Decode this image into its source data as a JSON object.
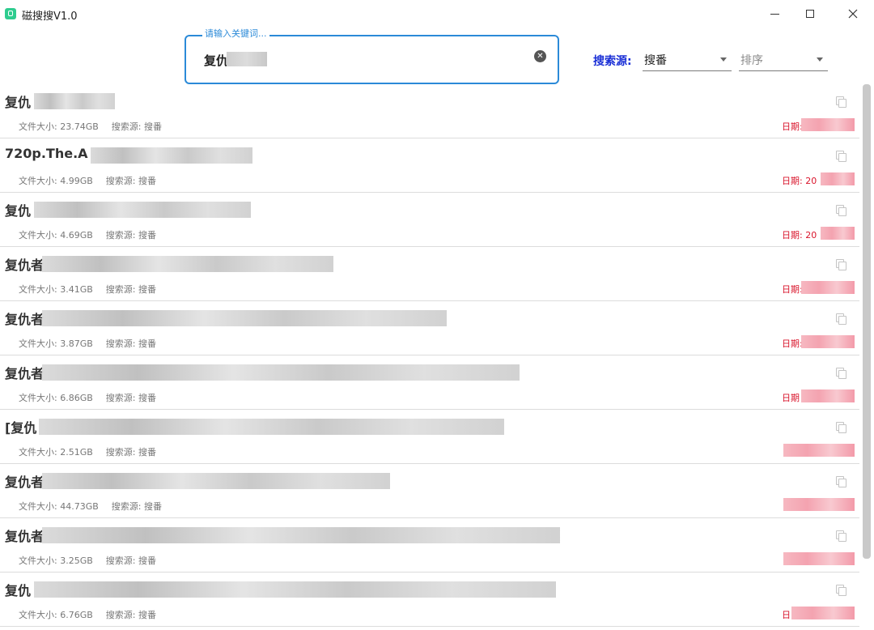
{
  "app": {
    "title": "磁搜搜V1.0"
  },
  "search": {
    "label": "请输入关键词...",
    "value": "复仇"
  },
  "filters": {
    "source_label": "搜索源:",
    "source_value": "搜番",
    "sort_placeholder": "排序"
  },
  "results": [
    {
      "title": "复仇",
      "size": "文件大小: 23.74GB",
      "source": "搜索源: 搜番",
      "date": "日期:"
    },
    {
      "title": "720p.The.A",
      "size": "文件大小: 4.99GB",
      "source": "搜索源: 搜番",
      "date": "日期: 20"
    },
    {
      "title": "复仇",
      "size": "文件大小: 4.69GB",
      "source": "搜索源: 搜番",
      "date": "日期: 20"
    },
    {
      "title": "复仇者",
      "size": "文件大小: 3.41GB",
      "source": "搜索源: 搜番",
      "date": "日期:"
    },
    {
      "title": "复仇者",
      "size": "文件大小: 3.87GB",
      "source": "搜索源: 搜番",
      "date": "日期:"
    },
    {
      "title": "复仇者",
      "size": "文件大小: 6.86GB",
      "source": "搜索源: 搜番",
      "date": "日期"
    },
    {
      "title": "[复仇",
      "size": "文件大小: 2.51GB",
      "source": "搜索源: 搜番",
      "date": ""
    },
    {
      "title": "复仇者",
      "size": "文件大小: 44.73GB",
      "source": "搜索源: 搜番",
      "date": ""
    },
    {
      "title": "复仇者",
      "size": "文件大小: 3.25GB",
      "source": "搜索源: 搜番",
      "date": ""
    },
    {
      "title": "复仇",
      "size": "文件大小: 6.76GB",
      "source": "搜索源: 搜番",
      "date": "日"
    }
  ],
  "icons": {
    "app": "app-logo-icon",
    "clear": "clear-circle-icon",
    "dropdown": "chevron-down-icon",
    "copy": "copy-icon"
  },
  "colors": {
    "accent_blue": "#2b8ad8",
    "source_label": "#1a2fd6",
    "date_red": "#d9142b",
    "app_icon_green": "#2ecc8f"
  }
}
